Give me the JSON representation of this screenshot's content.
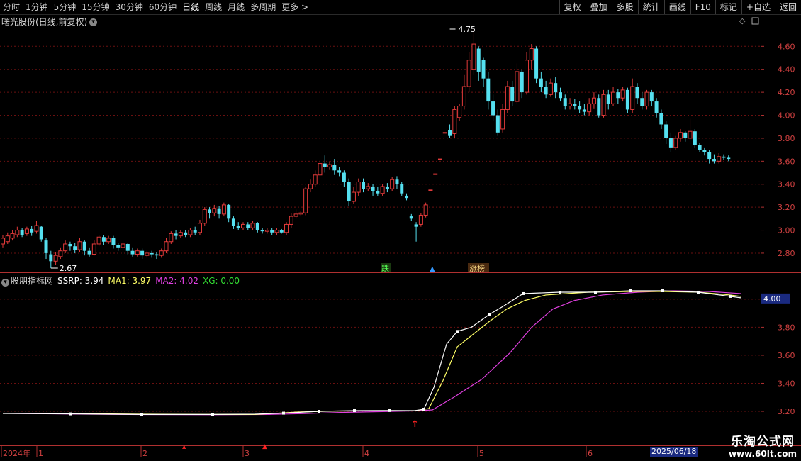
{
  "toolbar": {
    "periods": [
      "分时",
      "1分钟",
      "5分钟",
      "15分钟",
      "30分钟",
      "60分钟",
      "日线",
      "周线",
      "月线",
      "多周期",
      "更多 >"
    ],
    "active_period": "日线",
    "buttons": [
      "复权",
      "叠加",
      "多股",
      "统计",
      "画线",
      "F10",
      "标记",
      "+自选",
      "返回"
    ]
  },
  "header": {
    "title": "曙光股份(日线,前复权)"
  },
  "colors": {
    "up": "#e33a3a",
    "down": "#55e0f0",
    "ssrp": "#ffffff",
    "ma1": "#ffff66",
    "ma2": "#e040e0",
    "xg": "#33dd33",
    "grid": "#6a1010"
  },
  "price_axis": {
    "ticks": [
      "4.60",
      "4.40",
      "4.20",
      "4.00",
      "3.80",
      "3.60",
      "3.40",
      "3.20",
      "3.00",
      "2.80"
    ]
  },
  "price_annotations": {
    "high": "4.75",
    "low": "2.67"
  },
  "markers": {
    "die": "跌",
    "bang": "涨榜"
  },
  "indicator": {
    "name": "股朋指标网",
    "ssrp": "SSRP: 3.94",
    "ma1": "MA1: 3.97",
    "ma2": "MA2: 4.02",
    "xg": "XG: 0.00",
    "axis_ticks": [
      "4.00",
      "3.80",
      "3.60",
      "3.40",
      "3.20"
    ],
    "current_value": "4.00"
  },
  "date_axis": {
    "labels": [
      "2024年",
      "1",
      "2",
      "3",
      "4",
      "5",
      "6"
    ],
    "cursor_date": "2025/06/18"
  },
  "watermark": {
    "title": "乐淘公式网",
    "url": "www.60lt.com"
  }
}
